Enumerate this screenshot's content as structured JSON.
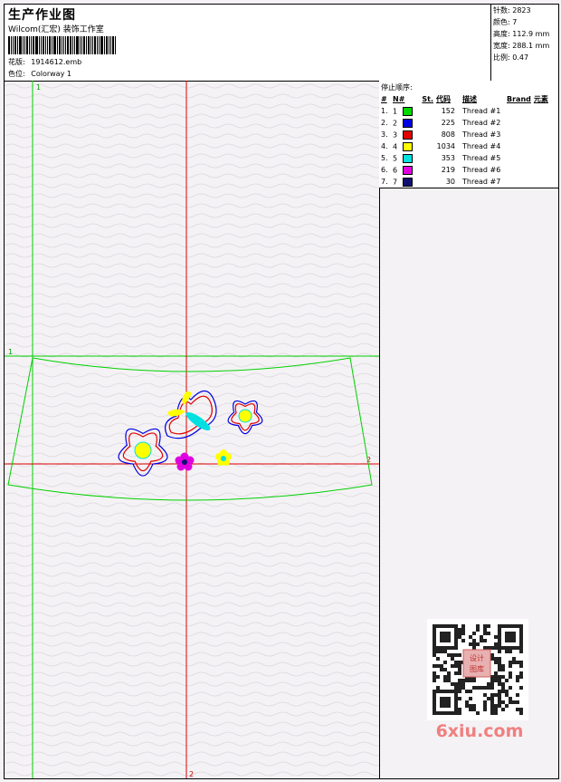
{
  "header": {
    "title": "生产作业图",
    "studio": "Wilcom(汇宏) 装饰工作室",
    "design_label": "花版:",
    "design_value": "1914612.emb",
    "colorway_label": "色位:",
    "colorway_value": "Colorway 1"
  },
  "stats": {
    "stitches": "针数: 2823",
    "colors": "颜色: 7",
    "height": "高度: 112.9 mm",
    "width": "宽度: 288.1 mm",
    "scale": "比例: 0.47"
  },
  "stop_sequence": {
    "title": "停止顺序:",
    "columns": [
      "#",
      "N#",
      "St.",
      "代码",
      "描述",
      "Brand",
      "元素"
    ],
    "rows": [
      {
        "num": "1.",
        "n": "1",
        "color": "#00d800",
        "code": "152",
        "desc": "Thread #1"
      },
      {
        "num": "2.",
        "n": "2",
        "color": "#0000e0",
        "code": "225",
        "desc": "Thread #2"
      },
      {
        "num": "3.",
        "n": "3",
        "color": "#e00000",
        "code": "808",
        "desc": "Thread #3"
      },
      {
        "num": "4.",
        "n": "4",
        "color": "#ffff00",
        "code": "1034",
        "desc": "Thread #4"
      },
      {
        "num": "5.",
        "n": "5",
        "color": "#00e0e0",
        "code": "353",
        "desc": "Thread #5"
      },
      {
        "num": "6.",
        "n": "6",
        "color": "#e000e0",
        "code": "219",
        "desc": "Thread #6"
      },
      {
        "num": "7.",
        "n": "7",
        "color": "#101070",
        "code": "30",
        "desc": "Thread #7"
      }
    ]
  },
  "design": {
    "guide_labels": {
      "top_left": "1",
      "left_mid": "1",
      "right_mid": "2",
      "bottom": "2"
    },
    "guide_colors": {
      "vertical_green": "#00d000",
      "red": "#e00000"
    }
  },
  "watermark": {
    "text": "6xiu.com",
    "stamp": "设计图库"
  }
}
